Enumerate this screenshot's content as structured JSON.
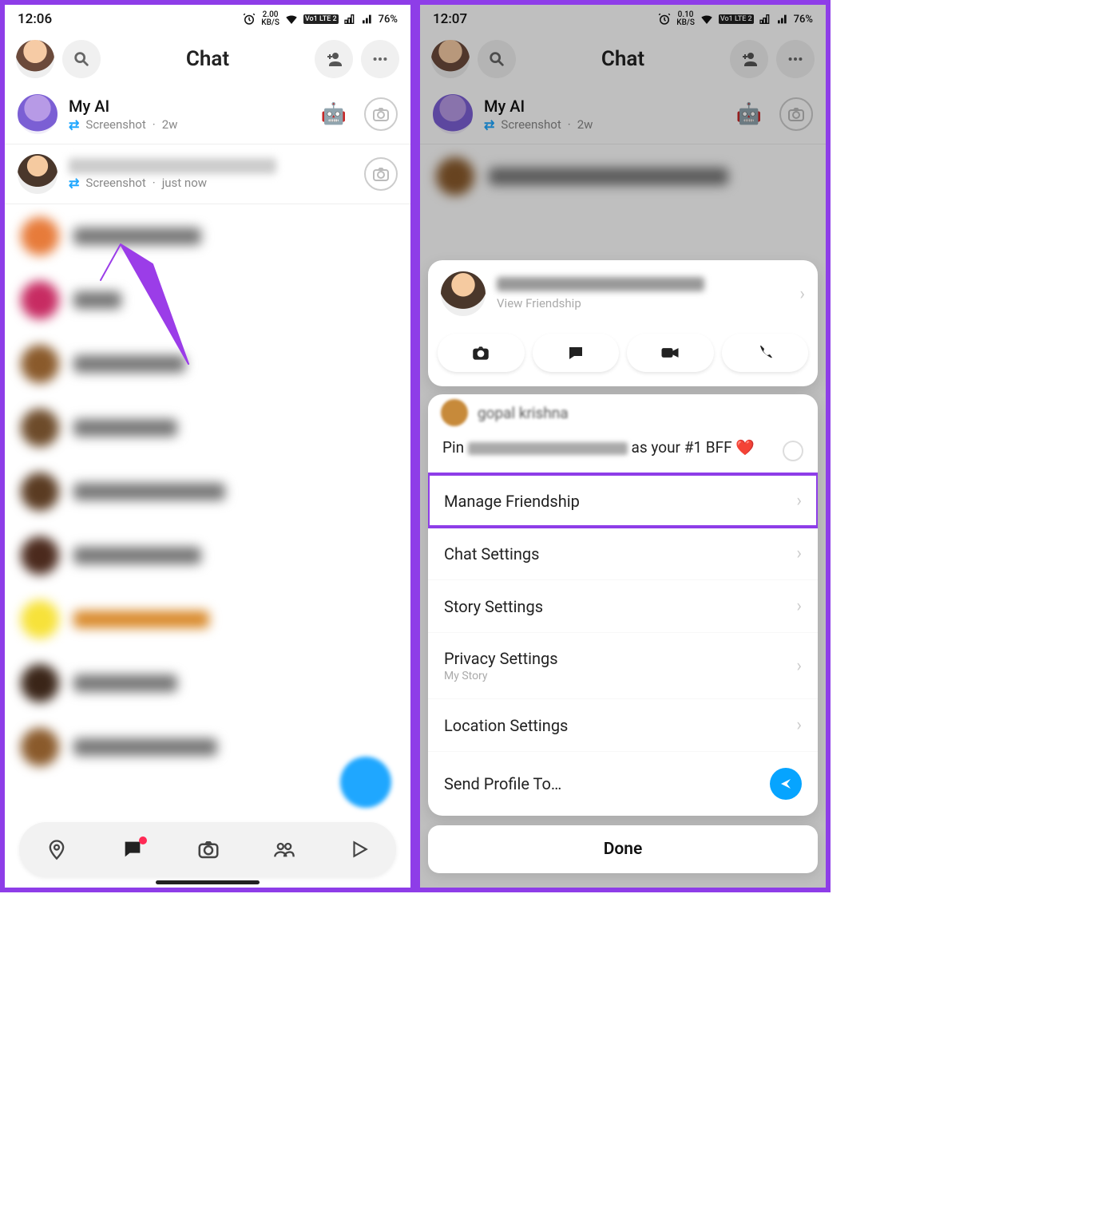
{
  "left": {
    "status": {
      "time": "12:06",
      "speed_val": "2.00",
      "speed_unit": "KB/S",
      "lte1": "Vo1\nLTE 2",
      "battery": "76%"
    },
    "header": {
      "title": "Chat"
    },
    "chats": [
      {
        "name": "My AI",
        "status_text": "Screenshot",
        "time": "2w",
        "screenshot_icon": "⇄"
      },
      {
        "name_blurred": true,
        "status_text": "Screenshot",
        "time": "just now",
        "screenshot_icon": "⇄"
      }
    ],
    "nav": {
      "items": [
        "map",
        "chat",
        "camera",
        "friends",
        "play"
      ]
    }
  },
  "right": {
    "status": {
      "time": "12:07",
      "speed_val": "0.10",
      "speed_unit": "KB/S",
      "lte1": "Vo1\nLTE 2",
      "battery": "76%"
    },
    "header": {
      "title": "Chat"
    },
    "chats_bg": [
      {
        "name": "My AI",
        "status_text": "Screenshot",
        "time": "2w"
      }
    ],
    "sheet": {
      "view_friendship": "View Friendship",
      "actions": [
        "camera",
        "chat",
        "video",
        "call"
      ],
      "peek_name": "gopal krishna",
      "pin_prefix": "Pin",
      "pin_suffix": "as your #1 BFF ❤️",
      "menu": {
        "manage": "Manage Friendship",
        "chat_settings": "Chat Settings",
        "story_settings": "Story Settings",
        "privacy_settings": "Privacy Settings",
        "privacy_sub": "My Story",
        "location_settings": "Location Settings",
        "send_profile": "Send Profile To…"
      },
      "done": "Done"
    }
  }
}
